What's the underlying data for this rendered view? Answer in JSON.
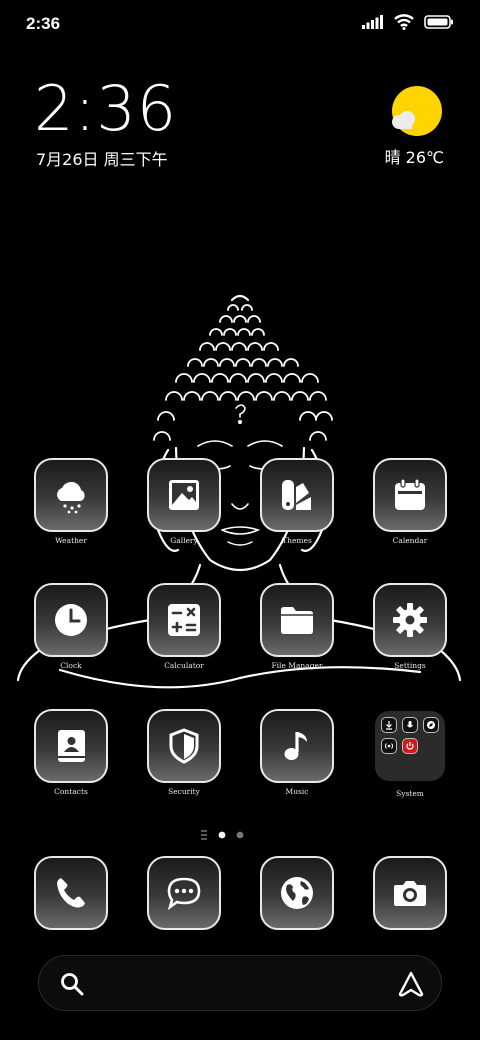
{
  "status_bar": {
    "time": "2:36",
    "icons": [
      "signal-icon",
      "wifi-icon",
      "battery-icon"
    ]
  },
  "clock_widget": {
    "time": "2:36",
    "date": "7月26日 周三下午"
  },
  "weather_widget": {
    "text": "晴 26℃",
    "icon": "sunny-cloud-icon",
    "sun_color": "#ffd400"
  },
  "apps": [
    {
      "label": "Weather",
      "icon": "cloud-rain-icon"
    },
    {
      "label": "Gallery",
      "icon": "image-icon"
    },
    {
      "label": "Themes",
      "icon": "themes-icon"
    },
    {
      "label": "Calendar",
      "icon": "calendar-icon"
    },
    {
      "label": "Clock",
      "icon": "clock-icon"
    },
    {
      "label": "Calculator",
      "icon": "calculator-icon"
    },
    {
      "label": "File Manager",
      "icon": "folder-icon"
    },
    {
      "label": "Settings",
      "icon": "gear-icon"
    },
    {
      "label": "Contacts",
      "icon": "contacts-icon"
    },
    {
      "label": "Security",
      "icon": "shield-icon"
    },
    {
      "label": "Music",
      "icon": "music-note-icon"
    },
    {
      "label": "System",
      "icon": "folder-group-icon"
    }
  ],
  "dock": [
    {
      "icon": "phone-icon"
    },
    {
      "icon": "message-icon"
    },
    {
      "icon": "globe-icon"
    },
    {
      "icon": "camera-icon"
    }
  ],
  "page_indicator": {
    "pages": 2,
    "current": 1
  },
  "search_bar": {
    "icons": [
      "search-icon",
      "assistant-icon"
    ]
  }
}
